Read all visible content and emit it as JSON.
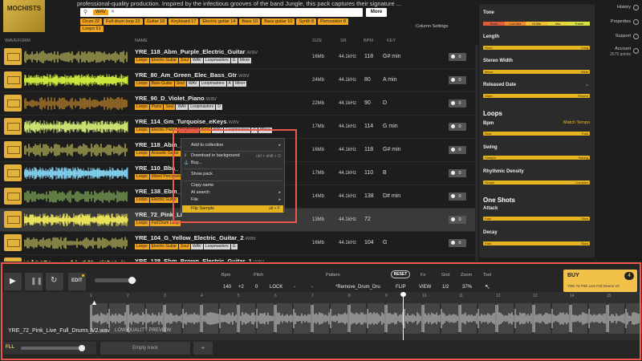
{
  "pack": {
    "cover_text": "MOCHISTS",
    "description": "professional-quality production. Inspired by the infectious grooves of the band Jungle, this pack captures their signature ...",
    "filter_chip": "WAV",
    "more_label": "More",
    "tags_row1": [
      "Drum 22",
      "Full drum loop 22",
      "Guitar 18",
      "Keyboard 17",
      "Electric guitar 14",
      "Bass 10",
      "Bass guitar 10",
      "Synth 8",
      "Percussion 8"
    ],
    "tags_row2": [
      "Loops 61"
    ],
    "column_settings": "Column Settings"
  },
  "columns": {
    "waveform": "WAVEFORM",
    "name": "NAME",
    "size": "SIZE",
    "sr": "SR",
    "bpm": "BPM",
    "key": "KEY"
  },
  "rows": [
    {
      "name": "YRE_118_Abm_Purple_Electric_Guitar",
      "ext": ".wav",
      "tags": [
        "Loops",
        "Electric Guitar",
        "Soul",
        "WAV",
        "Loopmasters",
        "G",
        "Minor"
      ],
      "size": "16Mb",
      "sr": "44.1kHz",
      "bpm": "118",
      "key": "G# min",
      "count": "0"
    },
    {
      "name": "YRE_80_Am_Green_Elec_Bass_Gtr",
      "ext": ".wav",
      "tags": [
        "Loops",
        "Bass Guitar",
        "Soul",
        "WAV",
        "Loopmasters",
        "A",
        "Minor"
      ],
      "size": "24Mb",
      "sr": "44.1kHz",
      "bpm": "80",
      "key": "A min",
      "count": "0"
    },
    {
      "name": "YRE_90_D_Violet_Piano",
      "ext": ".wav",
      "tags": [
        "Loops",
        "Piano",
        "Soul",
        "WAV",
        "Loopmasters",
        "D"
      ],
      "size": "22Mb",
      "sr": "44.1kHz",
      "bpm": "90",
      "key": "D",
      "count": "0"
    },
    {
      "name": "YRE_114_Gm_Turquoise_eKeys",
      "ext": ".wav",
      "tags": [
        "Loops",
        "Electric Piano",
        "Keyboard",
        "Soul",
        "WAV",
        "Loopmasters",
        "G",
        "Minor"
      ],
      "size": "17Mb",
      "sr": "44.1kHz",
      "bpm": "114",
      "key": "G min",
      "count": "0"
    },
    {
      "name": "YRE_118_Abm_F",
      "ext": "",
      "tags": [
        "Loops",
        "Acoustic Guitar"
      ],
      "size": "16Mb",
      "sr": "44.1kHz",
      "bpm": "118",
      "key": "G# min",
      "count": "0"
    },
    {
      "name": "YRE_110_Bba_",
      "ext": "",
      "tags": [
        "Loops",
        "Mixed Percussion"
      ],
      "size": "17Mb",
      "sr": "44.1kHz",
      "bpm": "110",
      "key": "B",
      "count": "0"
    },
    {
      "name": "YRE_138_Ebm_",
      "ext": "",
      "tags": [
        "Loops",
        "Electric Guitar"
      ],
      "size": "14Mb",
      "sr": "44.1kHz",
      "bpm": "138",
      "key": "D# min",
      "count": "0"
    },
    {
      "name": "YRE_72_Pink_Li",
      "ext": "",
      "tags": [
        "Loops",
        "Full Drum Loop"
      ],
      "size": "13Mb",
      "sr": "44.1kHz",
      "bpm": "72",
      "key": "",
      "count": "0"
    },
    {
      "name": "YRE_104_G_Yellow_Electric_Guitar_2",
      "ext": ".wav",
      "tags": [
        "Loops",
        "Electric Guitar",
        "Soul",
        "WAV",
        "Loopmasters",
        "G"
      ],
      "size": "16Mb",
      "sr": "44.1kHz",
      "bpm": "104",
      "key": "G",
      "count": "0"
    },
    {
      "name": "YRE_138_Ebm_Brown_Electric_Guitar_1",
      "ext": ".wav",
      "tags": [
        "Loops",
        "Electric Guitar"
      ],
      "size": "12Mb",
      "sr": "44.1kHz",
      "bpm": "138",
      "key": "D# min",
      "count": "0"
    }
  ],
  "context_menu": {
    "add_to_collection": "Add to collection",
    "download_bg": "Download in background",
    "download_bg_shortcut": "ctrl + shift + D",
    "buy": "Buy...",
    "show_pack": "Show pack",
    "copy_name": "Copy name",
    "ai_search": "AI search",
    "file": "File",
    "flip_sample": "Flip Sample",
    "flip_shortcut": "alt + F"
  },
  "filters": {
    "tone": "Tone",
    "tone_segments": [
      "Bass",
      "Low Mid",
      "Hi-Mid",
      "Mid",
      "Treble"
    ],
    "length": "Length",
    "length_min": "Short",
    "length_max": "Long",
    "stereo_width": "Stereo Width",
    "stereo_min": "Mono",
    "stereo_max": "Wide",
    "released_date": "Released Date",
    "released_min": "Older",
    "released_max": "Recent",
    "loops_heading": "Loops",
    "bpm": "Bpm",
    "match_tempo": "Match Tempo",
    "bpm_min": "Slow",
    "bpm_max": "Fast",
    "swing": "Swing",
    "swing_min": "Straight",
    "swing_max": "Swung",
    "rhythmic_density": "Rhythmic Density",
    "density_min": "Simple",
    "density_max": "Complex",
    "oneshots_heading": "One Shots",
    "attack": "Attack",
    "attack_min": "Fast",
    "attack_max": "Slow",
    "decay": "Decay",
    "decay_min": "Fast",
    "decay_max": "Slow"
  },
  "nav": {
    "history": "History",
    "properties": "Properties",
    "support": "Support",
    "account": "Account",
    "points": "2675 points"
  },
  "player": {
    "edit": "EDIT",
    "bpm_label": "Bpm",
    "pitch_label": "Pitch",
    "pattern_label": "Pattern",
    "reset": "RESET",
    "fx_label": "Fx",
    "grid_label": "Grid",
    "zoom_label": "Zoom",
    "tool_label": "Tool",
    "bpm_value": "140",
    "bpm_plus": "+2",
    "pitch_value": "0",
    "lock": "LOCK",
    "pattern_value": "*Remove_Drum_Dru",
    "flip": "FLIP",
    "view": "VIEW",
    "grid_value": "1/2",
    "zoom_value": "37%",
    "buy": "BUY",
    "buy_count": "4",
    "buy_item": "YRE 72 Pink Live Full Drums V2",
    "timeline_marks": [
      "1",
      "2",
      "3",
      "4",
      "5",
      "6",
      "7",
      "8",
      "9",
      "10",
      "11",
      "12",
      "13",
      "14",
      "15"
    ],
    "track_name": "YRE_72_Pink_Live_Full_Drums_V2.wav",
    "low_quality": "LOW QUALITY PREVIEW",
    "fll": "FLL",
    "empty_track": "Empty track",
    "add_track": "+"
  }
}
